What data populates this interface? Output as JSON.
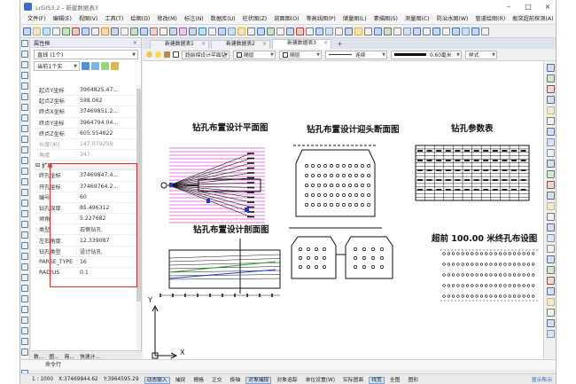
{
  "window": {
    "title": "LrGIS3.2 - 新建数据表3"
  },
  "menu": [
    "文件(F)",
    "编辑(E)",
    "视图(V)",
    "工具(T)",
    "绘图(D)",
    "修改(M)",
    "标注(N)",
    "数据库(U)",
    "柱状图(Z)",
    "剖面图(O)",
    "等高线图(P)",
    "储量图(L)",
    "素描图(S)",
    "测量图(C)",
    "防治水图(W)",
    "管道绘图(R)",
    "瓶突超前探测(A)",
    "帮助(H)"
  ],
  "panel": {
    "title": "属性框",
    "selector": "直线 (1个)",
    "subselector": "当前1个实",
    "properties": [
      {
        "key": "起点Y坐标",
        "value": "3964825.47...",
        "dim": false
      },
      {
        "key": "起点Z坐标",
        "value": "598.062",
        "dim": false
      },
      {
        "key": "终点X坐标",
        "value": "37469851.2...",
        "dim": false
      },
      {
        "key": "终点Y坐标",
        "value": "3964794.04...",
        "dim": false
      },
      {
        "key": "终点Z坐标",
        "value": "605.554622",
        "dim": false
      },
      {
        "key": "长度(米)",
        "value": "147.079259",
        "dim": true
      },
      {
        "key": "角度",
        "value": "347",
        "dim": true
      }
    ],
    "ext_section": "扩展",
    "ext_properties": [
      {
        "key": "终孔坐标",
        "value": "37469847.4..."
      },
      {
        "key": "开孔坐标",
        "value": "37469764.2..."
      },
      {
        "key": "编号",
        "value": "60"
      },
      {
        "key": "钻孔深度",
        "value": "85.496312"
      },
      {
        "key": "倾角",
        "value": "5.227682"
      },
      {
        "key": "类型",
        "value": "右侧钻孔"
      },
      {
        "key": "左右角度",
        "value": "12.339087"
      },
      {
        "key": "钻孔类型",
        "value": "设计钻孔"
      },
      {
        "key": "PARSE_TYPE",
        "value": "16"
      },
      {
        "key": "RADIUS",
        "value": "0.1"
      }
    ],
    "tabs": [
      "数...",
      "图...",
      "简...",
      "快速计..."
    ]
  },
  "doc_tabs": [
    "新建数据表1",
    "新建数据表2",
    "新建数据表3"
  ],
  "layerbar": {
    "layer": "超前探设计平面钻",
    "color": "随层",
    "linetype_layer": "随层",
    "linetype": "连续",
    "lineweight": "0.60毫米",
    "style": "样式"
  },
  "drawing": {
    "plan_title": "钻孔布置设计平面图",
    "section_title": "钻孔布置设计迎头断面图",
    "params_title": "钻孔参数表",
    "profile_title": "钻孔布置设计剖面图",
    "end_title": "超前  100.00  米终孔布设图",
    "axis_y": "Y",
    "axis_x": "X"
  },
  "command": {
    "label": "命令行"
  },
  "status": {
    "scale": "1 : 1000",
    "x": "X:37469844.62",
    "y": "Y:3964595.29",
    "toggles": [
      {
        "label": "动态输入",
        "on": true
      },
      {
        "label": "捕捉",
        "on": false
      },
      {
        "label": "栅格",
        "on": false
      },
      {
        "label": "正交",
        "on": false
      },
      {
        "label": "极轴",
        "on": false
      },
      {
        "label": "对象捕捉",
        "on": true
      },
      {
        "label": "对象追踪",
        "on": false
      },
      {
        "label": "单位设置(W)",
        "on": false
      },
      {
        "label": "实际图面",
        "on": false
      },
      {
        "label": "线宽",
        "on": true
      },
      {
        "label": "全图",
        "on": false
      },
      {
        "label": "图形",
        "on": false
      }
    ],
    "right_label": "显示所示"
  },
  "colors": {
    "highlight": "#e02a2a",
    "accent": "#3a6fc4",
    "magenta": "#d24fd2"
  }
}
